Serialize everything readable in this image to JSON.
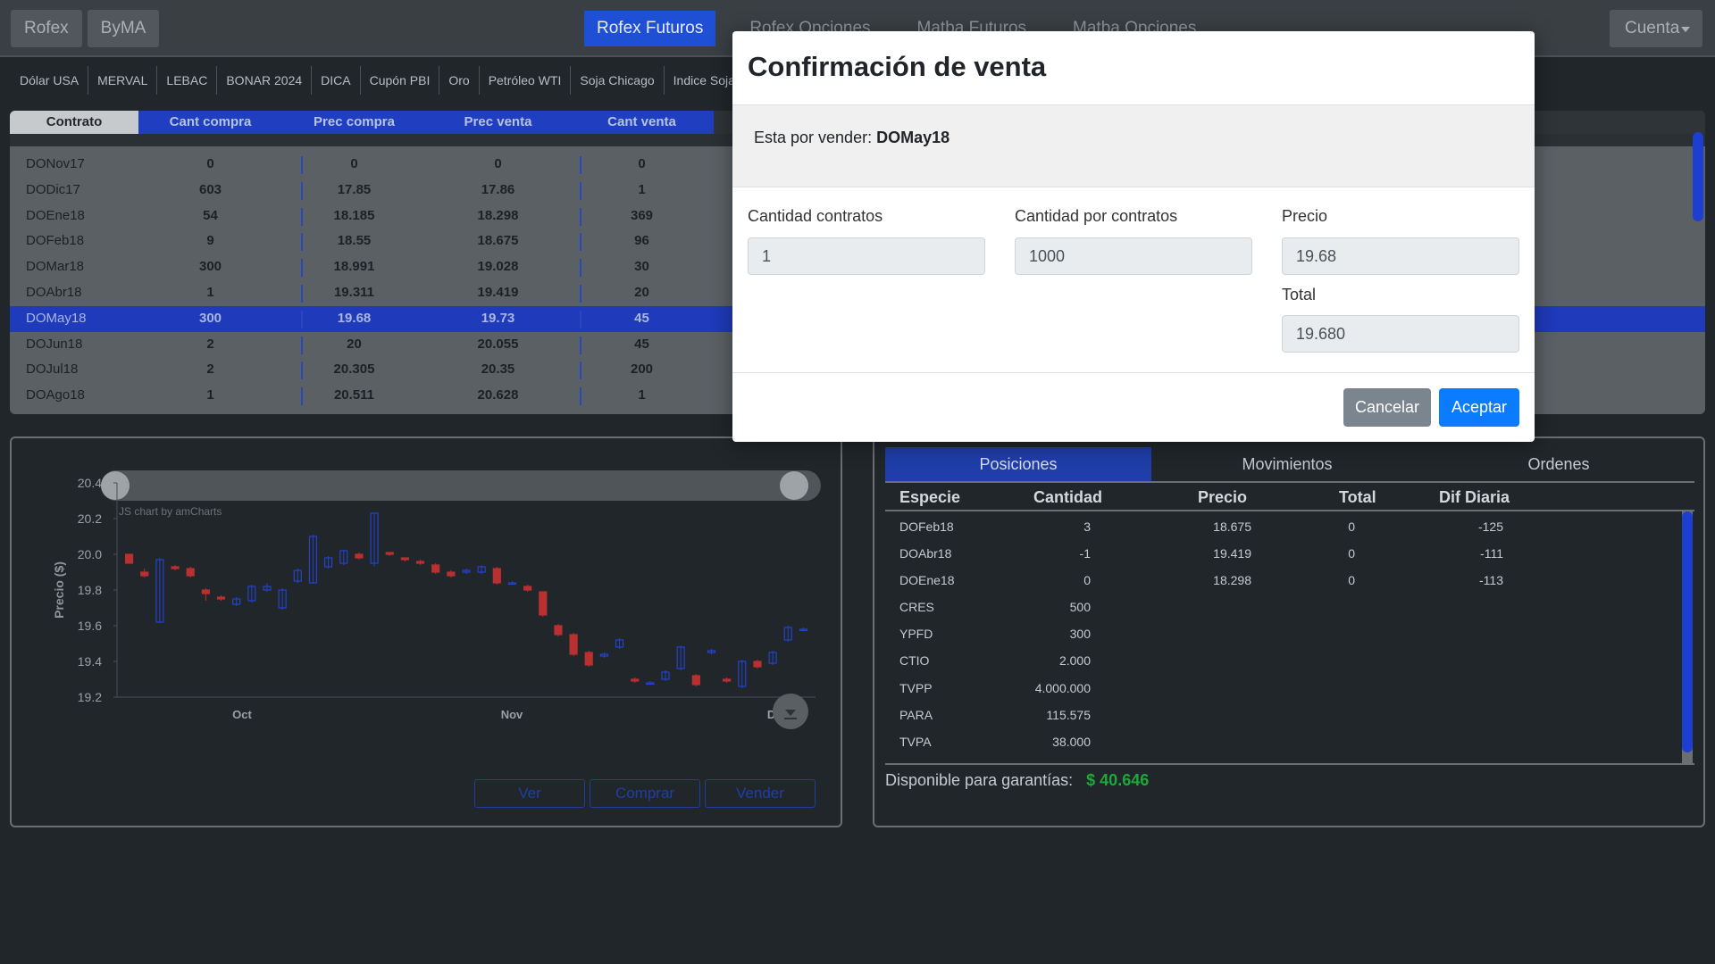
{
  "navbar": {
    "left_buttons": [
      "Rofex",
      "ByMA"
    ],
    "tabs": [
      "Rofex Futuros",
      "Rofex Opciones",
      "Matba Futuros",
      "Matba Opciones"
    ],
    "active_tab": "Rofex Futuros",
    "account_label": "Cuenta"
  },
  "subnav": [
    "Dólar USA",
    "MERVAL",
    "LEBAC",
    "BONAR 2024",
    "DICA",
    "Cupón PBI",
    "Oro",
    "Petróleo WTI",
    "Soja Chicago",
    "Indice Soja Rosafé"
  ],
  "contracts": {
    "headers": [
      "Contrato",
      "Cant compra",
      "Prec compra",
      "Prec venta",
      "Cant venta"
    ],
    "rows": [
      {
        "contrato": "DONov17",
        "cant_compra": "0",
        "prec_compra": "0",
        "prec_venta": "0",
        "cant_venta": "0"
      },
      {
        "contrato": "DODic17",
        "cant_compra": "603",
        "prec_compra": "17.85",
        "prec_venta": "17.86",
        "cant_venta": "1"
      },
      {
        "contrato": "DOEne18",
        "cant_compra": "54",
        "prec_compra": "18.185",
        "prec_venta": "18.298",
        "cant_venta": "369"
      },
      {
        "contrato": "DOFeb18",
        "cant_compra": "9",
        "prec_compra": "18.55",
        "prec_venta": "18.675",
        "cant_venta": "96"
      },
      {
        "contrato": "DOMar18",
        "cant_compra": "300",
        "prec_compra": "18.991",
        "prec_venta": "19.028",
        "cant_venta": "30"
      },
      {
        "contrato": "DOAbr18",
        "cant_compra": "1",
        "prec_compra": "19.311",
        "prec_venta": "19.419",
        "cant_venta": "20"
      },
      {
        "contrato": "DOMay18",
        "cant_compra": "300",
        "prec_compra": "19.68",
        "prec_venta": "19.73",
        "cant_venta": "45",
        "selected": true
      },
      {
        "contrato": "DOJun18",
        "cant_compra": "2",
        "prec_compra": "20",
        "prec_venta": "20.055",
        "cant_venta": "45"
      },
      {
        "contrato": "DOJul18",
        "cant_compra": "2",
        "prec_compra": "20.305",
        "prec_venta": "20.35",
        "cant_venta": "200"
      },
      {
        "contrato": "DOAgo18",
        "cant_compra": "1",
        "prec_compra": "20.511",
        "prec_venta": "20.628",
        "cant_venta": "1"
      }
    ]
  },
  "chart_panel": {
    "watermark": "JS chart by amCharts",
    "buttons": [
      "Ver",
      "Comprar",
      "Vender"
    ]
  },
  "chart_data": {
    "type": "candlestick",
    "ylabel": "Precio ($)",
    "ylim": [
      19.2,
      20.4
    ],
    "yticks": [
      "20.4",
      "20.2",
      "20.0",
      "19.8",
      "19.6",
      "19.4",
      "19.2"
    ],
    "xticks": [
      "Oct",
      "Nov",
      "Dic"
    ],
    "colors": {
      "up": "#2244cc",
      "down": "#b83030"
    },
    "candles": [
      {
        "o": 20.0,
        "c": 19.95,
        "h": 20.0,
        "l": 19.95
      },
      {
        "o": 19.9,
        "c": 19.88,
        "h": 19.92,
        "l": 19.87
      },
      {
        "o": 19.62,
        "c": 19.97,
        "h": 19.98,
        "l": 19.62
      },
      {
        "o": 19.93,
        "c": 19.92,
        "h": 19.94,
        "l": 19.91
      },
      {
        "o": 19.92,
        "c": 19.88,
        "h": 19.93,
        "l": 19.87
      },
      {
        "o": 19.8,
        "c": 19.78,
        "h": 19.81,
        "l": 19.74
      },
      {
        "o": 19.76,
        "c": 19.75,
        "h": 19.77,
        "l": 19.74
      },
      {
        "o": 19.72,
        "c": 19.75,
        "h": 19.76,
        "l": 19.71
      },
      {
        "o": 19.74,
        "c": 19.82,
        "h": 19.83,
        "l": 19.73
      },
      {
        "o": 19.8,
        "c": 19.82,
        "h": 19.84,
        "l": 19.79
      },
      {
        "o": 19.7,
        "c": 19.8,
        "h": 19.81,
        "l": 19.69
      },
      {
        "o": 19.85,
        "c": 19.91,
        "h": 19.92,
        "l": 19.84
      },
      {
        "o": 19.84,
        "c": 20.1,
        "h": 20.11,
        "l": 19.84
      },
      {
        "o": 19.93,
        "c": 19.98,
        "h": 19.99,
        "l": 19.92
      },
      {
        "o": 19.95,
        "c": 20.02,
        "h": 20.02,
        "l": 19.94
      },
      {
        "o": 20.0,
        "c": 19.98,
        "h": 20.01,
        "l": 19.97
      },
      {
        "o": 19.95,
        "c": 20.23,
        "h": 20.23,
        "l": 19.93
      },
      {
        "o": 20.01,
        "c": 20.0,
        "h": 20.01,
        "l": 19.99
      },
      {
        "o": 19.98,
        "c": 19.97,
        "h": 19.98,
        "l": 19.96
      },
      {
        "o": 19.96,
        "c": 19.95,
        "h": 19.97,
        "l": 19.94
      },
      {
        "o": 19.94,
        "c": 19.9,
        "h": 19.95,
        "l": 19.89
      },
      {
        "o": 19.9,
        "c": 19.88,
        "h": 19.91,
        "l": 19.87
      },
      {
        "o": 19.9,
        "c": 19.91,
        "h": 19.92,
        "l": 19.89
      },
      {
        "o": 19.9,
        "c": 19.93,
        "h": 19.94,
        "l": 19.89
      },
      {
        "o": 19.92,
        "c": 19.84,
        "h": 19.93,
        "l": 19.83
      },
      {
        "o": 19.84,
        "c": 19.84,
        "h": 19.85,
        "l": 19.83
      },
      {
        "o": 19.82,
        "c": 19.8,
        "h": 19.83,
        "l": 19.79
      },
      {
        "o": 19.79,
        "c": 19.66,
        "h": 19.79,
        "l": 19.65
      },
      {
        "o": 19.6,
        "c": 19.55,
        "h": 19.61,
        "l": 19.54
      },
      {
        "o": 19.55,
        "c": 19.44,
        "h": 19.56,
        "l": 19.43
      },
      {
        "o": 19.45,
        "c": 19.38,
        "h": 19.46,
        "l": 19.37
      },
      {
        "o": 19.43,
        "c": 19.44,
        "h": 19.45,
        "l": 19.42
      },
      {
        "o": 19.48,
        "c": 19.52,
        "h": 19.53,
        "l": 19.47
      },
      {
        "o": 19.3,
        "c": 19.29,
        "h": 19.31,
        "l": 19.28
      },
      {
        "o": 19.28,
        "c": 19.28,
        "h": 19.29,
        "l": 19.27
      },
      {
        "o": 19.3,
        "c": 19.34,
        "h": 19.35,
        "l": 19.29
      },
      {
        "o": 19.36,
        "c": 19.48,
        "h": 19.49,
        "l": 19.35
      },
      {
        "o": 19.32,
        "c": 19.27,
        "h": 19.33,
        "l": 19.26
      },
      {
        "o": 19.45,
        "c": 19.46,
        "h": 19.47,
        "l": 19.44
      },
      {
        "o": 19.3,
        "c": 19.29,
        "h": 19.31,
        "l": 19.28
      },
      {
        "o": 19.26,
        "c": 19.4,
        "h": 19.41,
        "l": 19.25
      },
      {
        "o": 19.4,
        "c": 19.37,
        "h": 19.41,
        "l": 19.36
      },
      {
        "o": 19.39,
        "c": 19.45,
        "h": 19.46,
        "l": 19.38
      },
      {
        "o": 19.52,
        "c": 19.59,
        "h": 19.6,
        "l": 19.51
      },
      {
        "o": 19.58,
        "c": 19.58,
        "h": 19.59,
        "l": 19.57
      }
    ]
  },
  "positions": {
    "tabs": [
      "Posiciones",
      "Movimientos",
      "Ordenes"
    ],
    "active_tab": "Posiciones",
    "headers": [
      "Especie",
      "Cantidad",
      "Precio",
      "Total",
      "Dif Diaria"
    ],
    "rows": [
      {
        "especie": "DOFeb18",
        "cantidad": "3",
        "precio": "18.675",
        "total": "0",
        "dif": "-125"
      },
      {
        "especie": "DOAbr18",
        "cantidad": "-1",
        "precio": "19.419",
        "total": "0",
        "dif": "-111"
      },
      {
        "especie": "DOEne18",
        "cantidad": "0",
        "precio": "18.298",
        "total": "0",
        "dif": "-113"
      },
      {
        "especie": "CRES",
        "cantidad": "500",
        "precio": "",
        "total": "",
        "dif": ""
      },
      {
        "especie": "YPFD",
        "cantidad": "300",
        "precio": "",
        "total": "",
        "dif": ""
      },
      {
        "especie": "CTIO",
        "cantidad": "2.000",
        "precio": "",
        "total": "",
        "dif": ""
      },
      {
        "especie": "TVPP",
        "cantidad": "4.000.000",
        "precio": "",
        "total": "",
        "dif": ""
      },
      {
        "especie": "PARA",
        "cantidad": "115.575",
        "precio": "",
        "total": "",
        "dif": ""
      },
      {
        "especie": "TVPA",
        "cantidad": "38.000",
        "precio": "",
        "total": "",
        "dif": ""
      }
    ],
    "disponible_label": "Disponible para garantías:",
    "disponible_value": "$ 40.646"
  },
  "modal": {
    "title": "Confirmación de venta",
    "info_prefix": "Esta por vender:",
    "info_contract": "DOMay18",
    "fields": {
      "cantidad_contratos_label": "Cantidad contratos",
      "cantidad_contratos_value": "1",
      "cantidad_por_contratos_label": "Cantidad por contratos",
      "cantidad_por_contratos_value": "1000",
      "precio_label": "Precio",
      "precio_value": "19.68",
      "total_label": "Total",
      "total_value": "19.680"
    },
    "cancel_label": "Cancelar",
    "ok_label": "Aceptar"
  }
}
